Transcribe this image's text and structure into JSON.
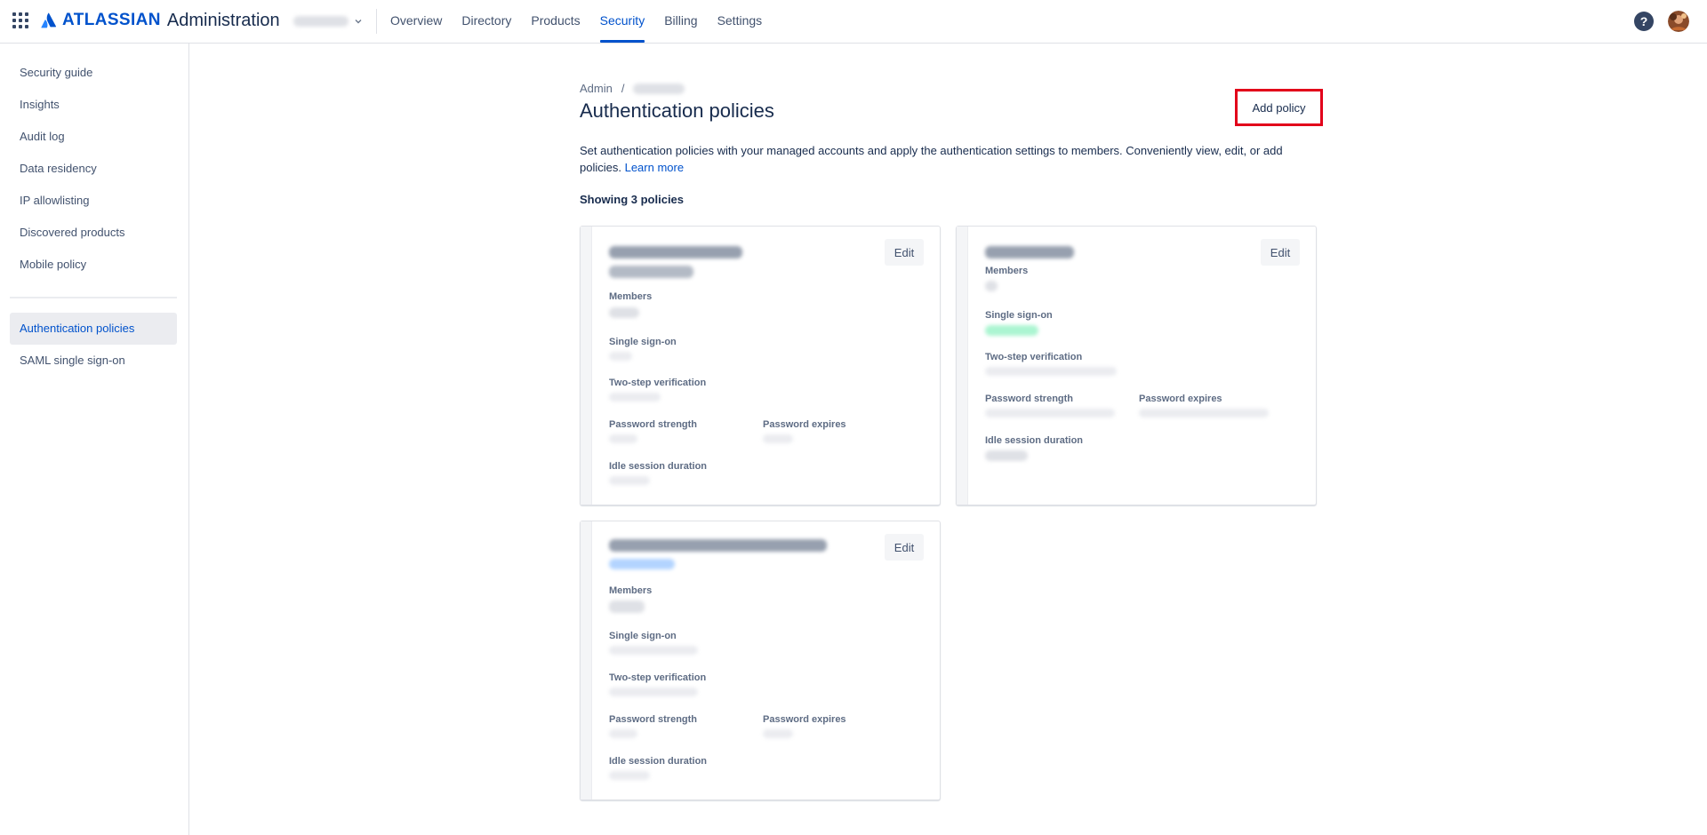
{
  "header": {
    "brand": "ATLASSIAN",
    "app_name": "Administration",
    "nav": [
      "Overview",
      "Directory",
      "Products",
      "Security",
      "Billing",
      "Settings"
    ],
    "active_nav": "Security",
    "help_icon_glyph": "?"
  },
  "sidebar": {
    "items": [
      "Security guide",
      "Insights",
      "Audit log",
      "Data residency",
      "IP allowlisting",
      "Discovered products",
      "Mobile policy",
      "Authentication policies",
      "SAML single sign-on"
    ],
    "active_item": "Authentication policies"
  },
  "main": {
    "breadcrumb_root": "Admin",
    "breadcrumb_sep": "/",
    "title": "Authentication policies",
    "add_policy": "Add policy",
    "description": "Set authentication policies with your managed accounts and apply the authentication settings to members. Conveniently view, edit, or add policies.",
    "learn_more": "Learn more",
    "showing": "Showing 3 policies"
  },
  "cards": [
    {
      "edit": "Edit",
      "labels": {
        "members": "Members",
        "sso": "Single sign-on",
        "two_step": "Two-step verification",
        "pw_strength": "Password strength",
        "pw_expires": "Password expires",
        "idle": "Idle session duration"
      }
    },
    {
      "edit": "Edit",
      "labels": {
        "members": "Members",
        "sso": "Single sign-on",
        "two_step": "Two-step verification",
        "pw_strength": "Password strength",
        "pw_expires": "Password expires",
        "idle": "Idle session duration"
      }
    },
    {
      "edit": "Edit",
      "labels": {
        "members": "Members",
        "sso": "Single sign-on",
        "two_step": "Two-step verification",
        "pw_strength": "Password strength",
        "pw_expires": "Password expires",
        "idle": "Idle session duration"
      }
    }
  ],
  "colors": {
    "brand_blue": "#0052cc",
    "highlight_red": "#e2001a",
    "text": "#172b4d",
    "subtle": "#5e6c84"
  }
}
